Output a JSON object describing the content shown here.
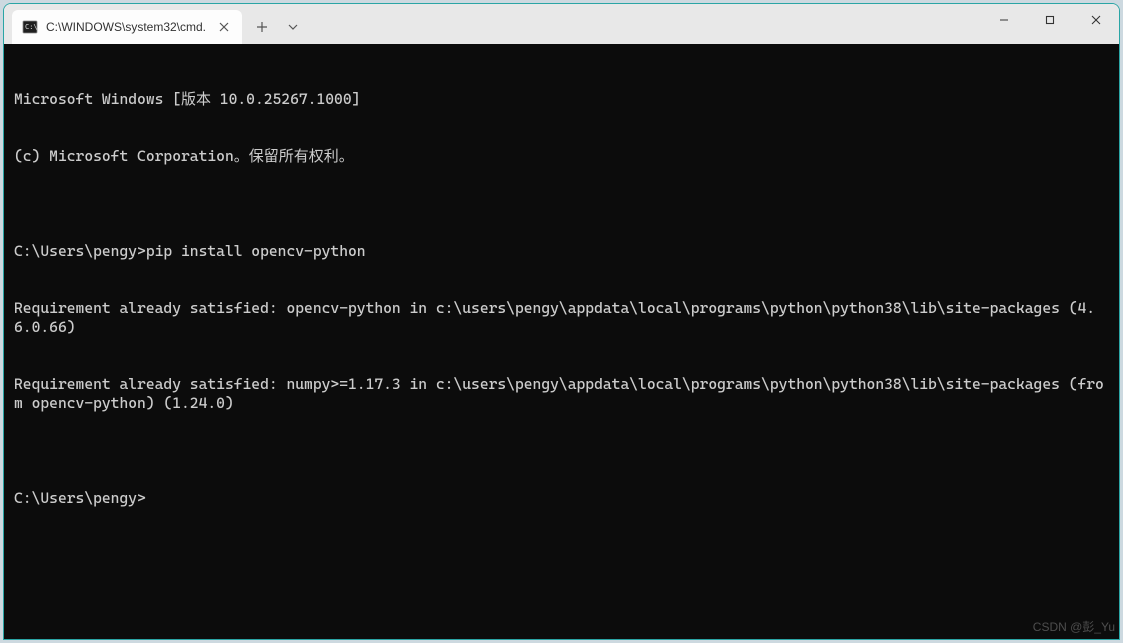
{
  "tab": {
    "title": "C:\\WINDOWS\\system32\\cmd."
  },
  "terminal": {
    "lines": [
      "Microsoft Windows [版本 10.0.25267.1000]",
      "(c) Microsoft Corporation。保留所有权利。",
      "",
      "C:\\Users\\pengy>pip install opencv-python",
      "Requirement already satisfied: opencv-python in c:\\users\\pengy\\appdata\\local\\programs\\python\\python38\\lib\\site-packages (4.6.0.66)",
      "Requirement already satisfied: numpy>=1.17.3 in c:\\users\\pengy\\appdata\\local\\programs\\python\\python38\\lib\\site-packages (from opencv-python) (1.24.0)",
      "",
      "C:\\Users\\pengy>"
    ]
  },
  "watermark": "CSDN @彭_Yu"
}
